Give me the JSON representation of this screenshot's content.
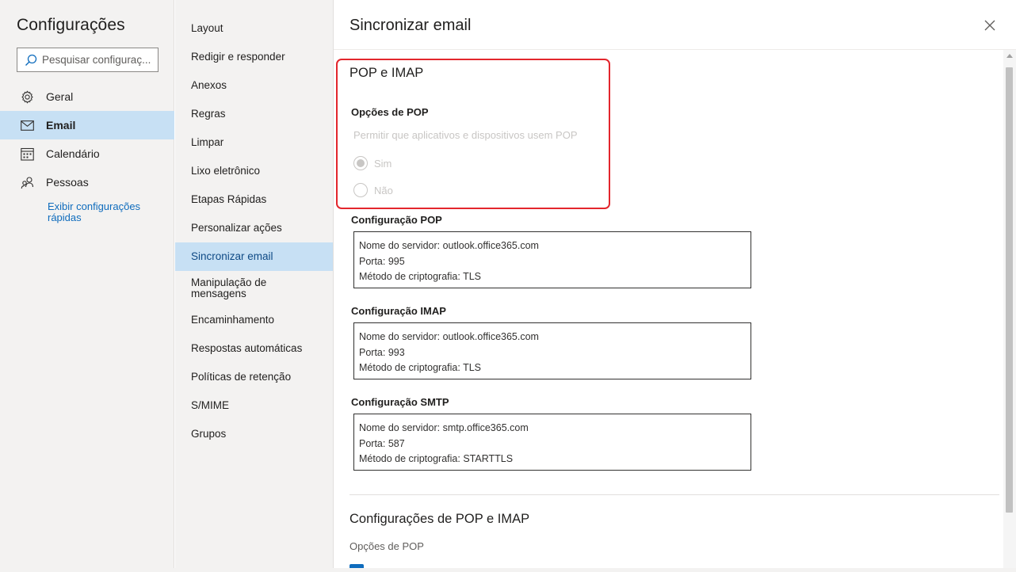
{
  "left_pane": {
    "title": "Configurações",
    "search_placeholder": "Pesquisar configuraç...",
    "nav": [
      {
        "label": "Geral",
        "icon": "gear-icon"
      },
      {
        "label": "Email",
        "icon": "mail-icon",
        "selected": true
      },
      {
        "label": "Calendário",
        "icon": "calendar-icon"
      },
      {
        "label": "Pessoas",
        "icon": "people-icon"
      }
    ],
    "quick_settings_link": "Exibir configurações rápidas"
  },
  "mid_pane": {
    "items": [
      {
        "label": "Layout"
      },
      {
        "label": "Redigir e responder"
      },
      {
        "label": "Anexos"
      },
      {
        "label": "Regras"
      },
      {
        "label": "Limpar"
      },
      {
        "label": "Lixo eletrônico"
      },
      {
        "label": "Etapas Rápidas"
      },
      {
        "label": "Personalizar ações"
      },
      {
        "label": "Sincronizar email",
        "selected": true
      },
      {
        "label": "Manipulação de mensagens"
      },
      {
        "label": "Encaminhamento"
      },
      {
        "label": "Respostas automáticas"
      },
      {
        "label": "Políticas de retenção"
      },
      {
        "label": "S/MIME"
      },
      {
        "label": "Grupos"
      }
    ]
  },
  "content": {
    "title": "Sincronizar email",
    "close_icon": "close-icon",
    "pop_imap": {
      "heading": "POP e IMAP",
      "pop_options_label": "Opções de POP",
      "pop_permission_text": "Permitir que aplicativos e dispositivos usem POP",
      "radio_yes": "Sim",
      "radio_no": "Não",
      "selected": "Sim"
    },
    "pop_config": {
      "label": "Configuração POP",
      "lines": [
        "Nome do servidor: outlook.office365.com",
        "Porta: 995",
        "Método de criptografia: TLS"
      ]
    },
    "imap_config": {
      "label": "Configuração IMAP",
      "lines": [
        "Nome do servidor: outlook.office365.com",
        "Porta: 993",
        "Método de criptografia: TLS"
      ]
    },
    "smtp_config": {
      "label": "Configuração SMTP",
      "lines": [
        "Nome do servidor: smtp.office365.com",
        "Porta: 587",
        "Método de criptografia: STARTTLS"
      ]
    },
    "section2": {
      "heading": "Configurações de POP e IMAP",
      "subheading": "Opções de POP"
    }
  },
  "colors": {
    "accent": "#0f6cbd",
    "selected_bg": "#c7e0f4",
    "highlight_border": "#e3262d",
    "pane_bg": "#f3f2f1"
  }
}
